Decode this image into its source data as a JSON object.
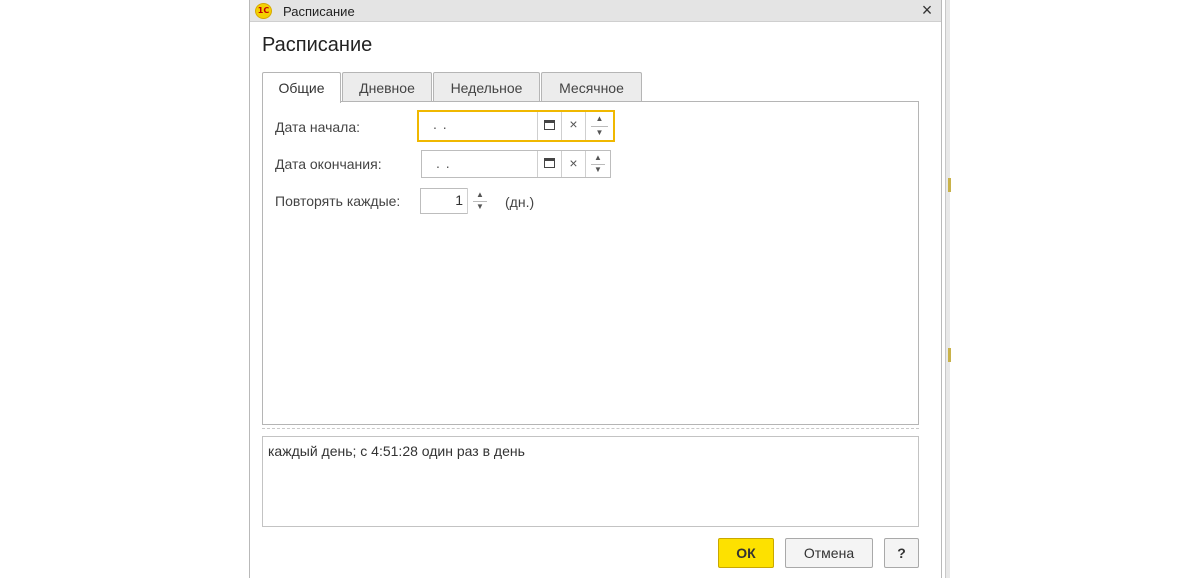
{
  "window": {
    "title": "Расписание",
    "icon_text": "1С",
    "close_glyph": "×"
  },
  "form": {
    "title": "Расписание"
  },
  "tabs": [
    {
      "label": "Общие",
      "active": true
    },
    {
      "label": "Дневное",
      "active": false
    },
    {
      "label": "Недельное",
      "active": false
    },
    {
      "label": "Месячное",
      "active": false
    }
  ],
  "general": {
    "start_date": {
      "label": "Дата начала:",
      "value": " .  ."
    },
    "end_date": {
      "label": "Дата окончания:",
      "value": " .  ."
    },
    "repeat": {
      "label": "Повторять каждые:",
      "value": "1",
      "unit": "(дн.)"
    }
  },
  "glyphs": {
    "clear": "×",
    "up": "▲",
    "down": "▼"
  },
  "description": {
    "text": "каждый день; с 4:51:28 один раз в день"
  },
  "buttons": {
    "ok": "ОК",
    "cancel": "Отмена",
    "help": "?"
  },
  "colors": {
    "accent": "#fde100",
    "focus_border": "#f0b800"
  }
}
